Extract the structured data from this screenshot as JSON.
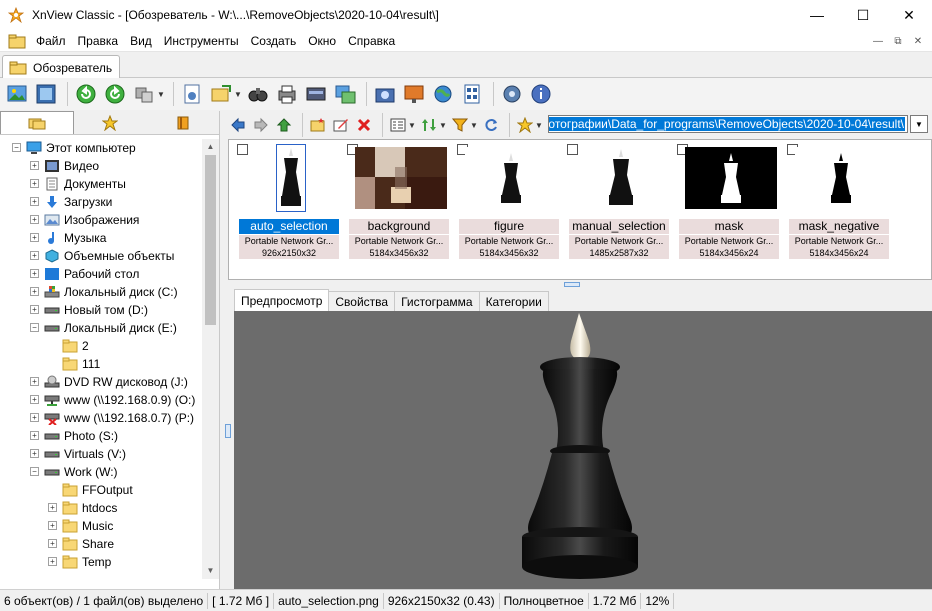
{
  "window": {
    "title": "XnView Classic - [Обозреватель - W:\\...\\RemoveObjects\\2020-10-04\\result\\]",
    "minimize_icon": "minimize-icon",
    "maximize_icon": "maximize-icon",
    "close_icon": "close-icon"
  },
  "menu": {
    "items": [
      "Файл",
      "Правка",
      "Вид",
      "Инструменты",
      "Создать",
      "Окно",
      "Справка"
    ]
  },
  "doc_tab": {
    "label": "Обозреватель"
  },
  "tree": {
    "items": [
      {
        "label": "Этот компьютер",
        "icon": "computer-icon"
      },
      {
        "label": "Видео",
        "icon": "video-folder-icon"
      },
      {
        "label": "Документы",
        "icon": "documents-folder-icon"
      },
      {
        "label": "Загрузки",
        "icon": "downloads-folder-icon"
      },
      {
        "label": "Изображения",
        "icon": "pictures-folder-icon"
      },
      {
        "label": "Музыка",
        "icon": "music-folder-icon"
      },
      {
        "label": "Объемные объекты",
        "icon": "3d-objects-folder-icon"
      },
      {
        "label": "Рабочий стол",
        "icon": "desktop-folder-icon"
      },
      {
        "label": "Локальный диск (C:)",
        "icon": "system-drive-icon"
      },
      {
        "label": "Новый том (D:)",
        "icon": "drive-icon"
      },
      {
        "label": "Локальный диск (E:)",
        "icon": "drive-icon"
      },
      {
        "label": "2",
        "icon": "folder-icon"
      },
      {
        "label": "111",
        "icon": "folder-icon"
      },
      {
        "label": "DVD RW дисковод (J:)",
        "icon": "dvd-drive-icon"
      },
      {
        "label": "www (\\\\192.168.0.9) (O:)",
        "icon": "network-drive-icon"
      },
      {
        "label": "www (\\\\192.168.0.7) (P:)",
        "icon": "network-drive-disconnected-icon"
      },
      {
        "label": "Photo (S:)",
        "icon": "drive-icon"
      },
      {
        "label": "Virtuals (V:)",
        "icon": "drive-icon"
      },
      {
        "label": "Work (W:)",
        "icon": "drive-icon"
      },
      {
        "label": "FFOutput",
        "icon": "folder-icon"
      },
      {
        "label": "htdocs",
        "icon": "folder-icon"
      },
      {
        "label": "Music",
        "icon": "folder-icon"
      },
      {
        "label": "Share",
        "icon": "folder-icon"
      },
      {
        "label": "Temp",
        "icon": "folder-icon"
      }
    ]
  },
  "path": {
    "value": "отографии\\Data_for_programs\\RemoveObjects\\2020-10-04\\result\\"
  },
  "thumbnails": [
    {
      "name": "auto_selection",
      "type": "Portable Network Gr...",
      "size": "926x2150x32",
      "selected": true
    },
    {
      "name": "background",
      "type": "Portable Network Gr...",
      "size": "5184x3456x32",
      "selected": false
    },
    {
      "name": "figure",
      "type": "Portable Network Gr...",
      "size": "5184x3456x32",
      "selected": false
    },
    {
      "name": "manual_selection",
      "type": "Portable Network Gr...",
      "size": "1485x2587x32",
      "selected": false
    },
    {
      "name": "mask",
      "type": "Portable Network Gr...",
      "size": "5184x3456x24",
      "selected": false
    },
    {
      "name": "mask_negative",
      "type": "Portable Network Gr...",
      "size": "5184x3456x24",
      "selected": false
    }
  ],
  "preview_tabs": [
    "Предпросмотр",
    "Свойства",
    "Гистограмма",
    "Категории"
  ],
  "status": {
    "selection": "6 объект(ов) / 1 файл(ов) выделено",
    "sel_size": "[ 1.72 Мб ]",
    "filename": "auto_selection.png",
    "dimensions": "926x2150x32 (0.43)",
    "color_mode": "Полноцветное",
    "file_size": "1.72 Мб",
    "zoom": "12%"
  },
  "colors": {
    "selection": "#0078d7",
    "thumb_label_bg": "#eadcdc",
    "preview_bg": "#6c6c6c"
  }
}
